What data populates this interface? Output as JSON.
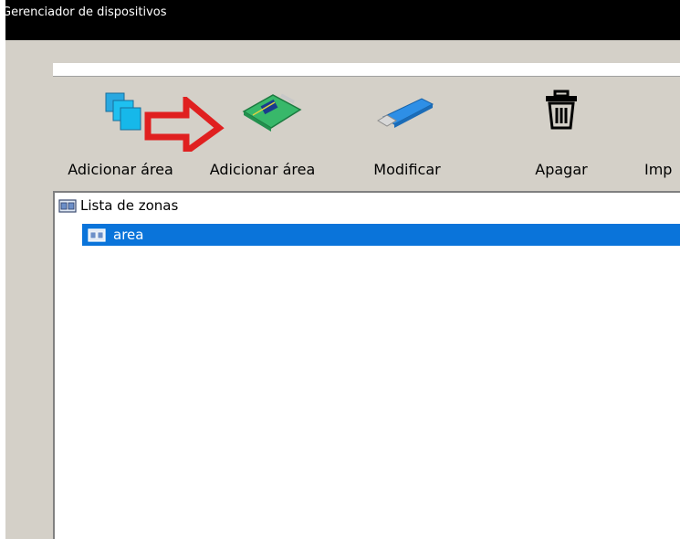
{
  "window": {
    "title": "Gerenciador de dispositivos"
  },
  "toolbar": {
    "items": [
      {
        "label": "Adicionar área",
        "icon": "add-area-icon"
      },
      {
        "label": "Adicionar área",
        "icon": "add-device-card-icon"
      },
      {
        "label": "Modificar",
        "icon": "modify-usb-icon"
      },
      {
        "label": "Apagar",
        "icon": "trash-icon"
      },
      {
        "label": "Imp",
        "icon": ""
      }
    ],
    "annotation": "red-arrow-icon"
  },
  "tree": {
    "root_label": "Lista de zonas",
    "items": [
      {
        "label": "area",
        "selected": true
      }
    ]
  },
  "colors": {
    "selection": "#0a74da",
    "titlebar": "#000000",
    "client_bg": "#d4d0c8",
    "annotation_arrow": "#e02020"
  }
}
